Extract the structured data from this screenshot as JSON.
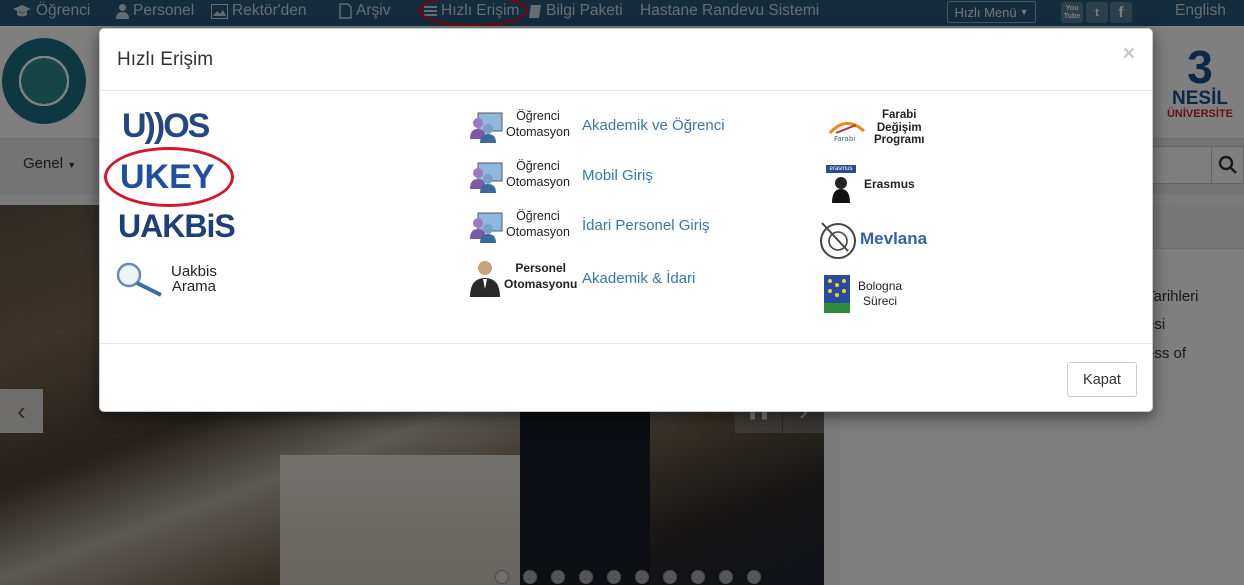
{
  "topnav": {
    "items": [
      {
        "label": "Öğrenci",
        "icon": "graduation-cap-icon"
      },
      {
        "label": "Personel",
        "icon": "user-icon"
      },
      {
        "label": "Rektör'den",
        "icon": "image-icon"
      },
      {
        "label": "Arşiv",
        "icon": "document-icon"
      },
      {
        "label": "Hızlı Erişim",
        "icon": "list-icon"
      },
      {
        "label": "Bilgi Paketi",
        "icon": "book-icon"
      },
      {
        "label": "Hastane Randevu Sistemi",
        "icon": ""
      }
    ],
    "hizli_menu": "Hızlı Menü",
    "social": [
      {
        "icon": "youtube-icon",
        "glyph": "You Tube"
      },
      {
        "icon": "twitter-icon",
        "glyph": "t"
      },
      {
        "icon": "facebook-icon",
        "glyph": "f"
      }
    ],
    "language": "English",
    "highlight_color": "#d6162a"
  },
  "background": {
    "genel_menu": "Genel",
    "right_lines": [
      "Tarihleri",
      "esi",
      "ess of"
    ],
    "logo_right": {
      "big": "3",
      "line1": "NESİL",
      "line2": "ÜNİVERSİTE"
    }
  },
  "modal": {
    "title": "Hızlı Erişim",
    "close_glyph": "×",
    "close_button": "Kapat",
    "col1": [
      {
        "name": "udos-logo",
        "text": "U))OS"
      },
      {
        "name": "ukey-logo",
        "text": "UKEY"
      },
      {
        "name": "uakbis-logo",
        "text": "UAKBiS"
      },
      {
        "name": "uakbis-arama-logo",
        "line1": "Uakbis",
        "line2": "Arama"
      }
    ],
    "col2": [
      {
        "logo_line1": "Öğrenci",
        "logo_line2": "Otomasyon",
        "link": "Akademik ve Öğrenci"
      },
      {
        "logo_line1": "Öğrenci",
        "logo_line2": "Otomasyon",
        "link": "Mobil Giriş"
      },
      {
        "logo_line1": "Öğrenci",
        "logo_line2": "Otomasyon",
        "link": "İdari Personel Giriş"
      },
      {
        "logo_line1": "Personel",
        "logo_line2": "Otomasyonu",
        "link": "Akademik & İdari"
      }
    ],
    "col3": [
      {
        "name": "farabi-logo",
        "line1": "Farabi",
        "line2": "Değişim",
        "line3": "Programı"
      },
      {
        "name": "erasmus-logo",
        "label": "Erasmus",
        "tag": "erasmus"
      },
      {
        "name": "mevlana-logo",
        "label": "Mevlana"
      },
      {
        "name": "bologna-logo",
        "line1": "Bologna",
        "line2": "Süreci"
      }
    ],
    "link_color": "#3677b0"
  }
}
